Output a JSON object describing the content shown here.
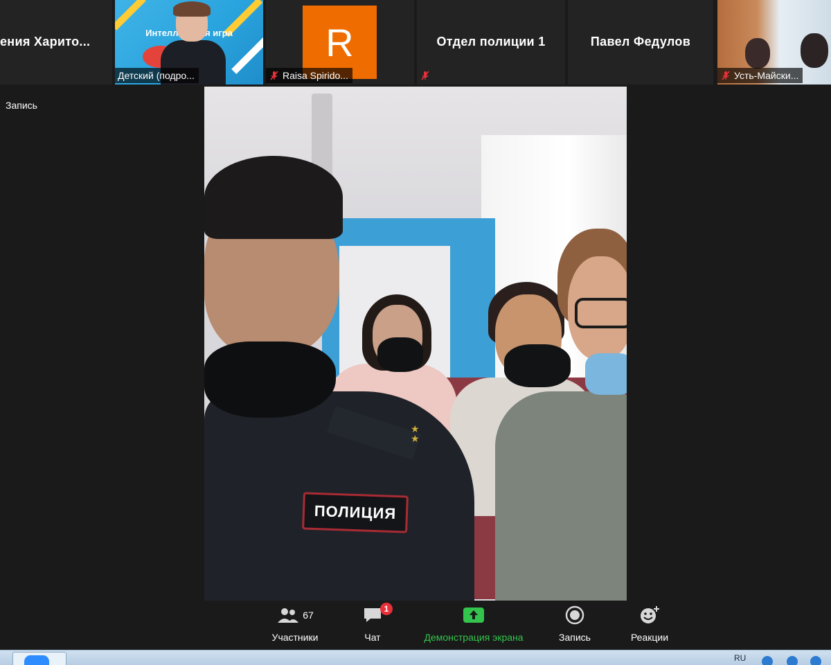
{
  "gallery": {
    "tile1_name": "ения  Харито...",
    "tile2_label": "Детский (подро...",
    "tile2_slide_text": "Интеллект    ная игра",
    "tile3_avatar_letter": "R",
    "tile3_label": "Raisa Spirido...",
    "tile4_name": "Отдел полиции 1",
    "tile5_name": "Павел Федулов",
    "tile6_label": "Усть-Майски..."
  },
  "recording_label": "Запись",
  "main_video": {
    "patch_text": "ПОЛИЦИЯ"
  },
  "toolbar": {
    "participants_label": "Участники",
    "participants_count": "67",
    "chat_label": "Чат",
    "chat_badge": "1",
    "share_label": "Демонстрация экрана",
    "record_label": "Запись",
    "reactions_label": "Реакции"
  },
  "taskbar": {
    "tray_lang": "RU"
  },
  "colors": {
    "background": "#1a1a1a",
    "share_green": "#33c44d",
    "badge_red": "#e8303a",
    "avatar_orange": "#ef6c00",
    "mic_off_red": "#e8303a"
  }
}
